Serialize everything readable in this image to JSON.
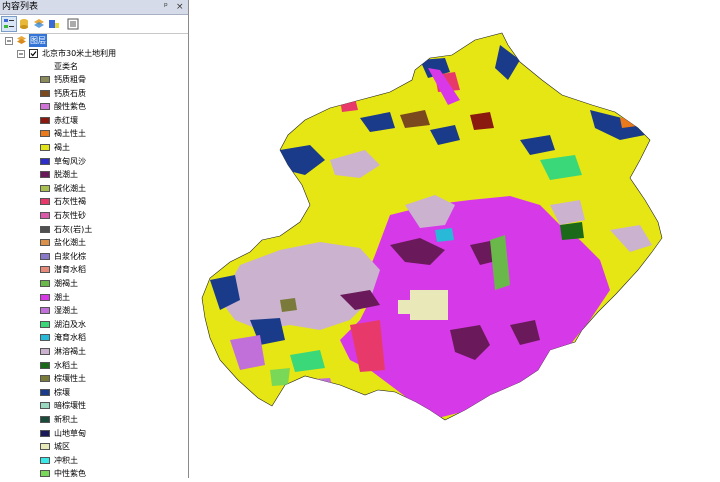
{
  "panel": {
    "title": "内容列表",
    "pin": "ᵖ",
    "close": "×"
  },
  "toolbar": {
    "buttons": [
      "list-by-drawing-order-icon",
      "list-by-source-icon",
      "list-by-visibility-icon",
      "list-by-selection-icon",
      "options-icon"
    ]
  },
  "tree": {
    "root_label": "图层",
    "layer_label": "北京市30米土地利用",
    "field_label": "亚类名",
    "classes": [
      {
        "label": "钙质粗骨",
        "color": "#8c8c5a"
      },
      {
        "label": "钙质石质",
        "color": "#7a4a1e"
      },
      {
        "label": "酸性紫色",
        "color": "#d074d8"
      },
      {
        "label": "赤红壤",
        "color": "#8a1a10"
      },
      {
        "label": "褐土性土",
        "color": "#e87a1c"
      },
      {
        "label": "褐土",
        "color": "#e3e31a"
      },
      {
        "label": "草甸风沙",
        "color": "#2e2ec8"
      },
      {
        "label": "脱潮土",
        "color": "#6a1a5a"
      },
      {
        "label": "碱化潮土",
        "color": "#a8c050"
      },
      {
        "label": "石灰性褐",
        "color": "#e83a6a"
      },
      {
        "label": "石灰性砂",
        "color": "#d85aa8"
      },
      {
        "label": "石灰(岩)土",
        "color": "#505050"
      },
      {
        "label": "盐化潮土",
        "color": "#d8904a"
      },
      {
        "label": "白浆化棕",
        "color": "#8a78c8"
      },
      {
        "label": "潜育水稻",
        "color": "#e88a7a"
      },
      {
        "label": "潮褐土",
        "color": "#6ab84a"
      },
      {
        "label": "潮土",
        "color": "#d838e8"
      },
      {
        "label": "湿潮土",
        "color": "#c070d8"
      },
      {
        "label": "湖泊及水",
        "color": "#3ad878"
      },
      {
        "label": "淹育水稻",
        "color": "#28b8d8"
      },
      {
        "label": "淋溶褐土",
        "color": "#cbb2cf"
      },
      {
        "label": "水稻土",
        "color": "#1a6a1a"
      },
      {
        "label": "棕壤性土",
        "color": "#7a7a3a"
      },
      {
        "label": "棕壤",
        "color": "#1a3a8a"
      },
      {
        "label": "暗棕壤性",
        "color": "#9ad8c0"
      },
      {
        "label": "新积土",
        "color": "#1a4a3a"
      },
      {
        "label": "山地草甸",
        "color": "#1a1a5a"
      },
      {
        "label": "城区",
        "color": "#e8e8b8"
      },
      {
        "label": "冲积土",
        "color": "#3ae8e8"
      },
      {
        "label": "中性紫色",
        "color": "#7ad858"
      }
    ]
  },
  "map_colors": {
    "main_yellow": "#e6e614",
    "magenta": "#d63ae8",
    "lavender": "#cbb2cf",
    "navy": "#1a3a8a",
    "maroon": "#6a1a5a",
    "green": "#3ad878",
    "urban": "#e8e8b8",
    "red": "#e83a6a",
    "brown": "#7a4a1e"
  }
}
